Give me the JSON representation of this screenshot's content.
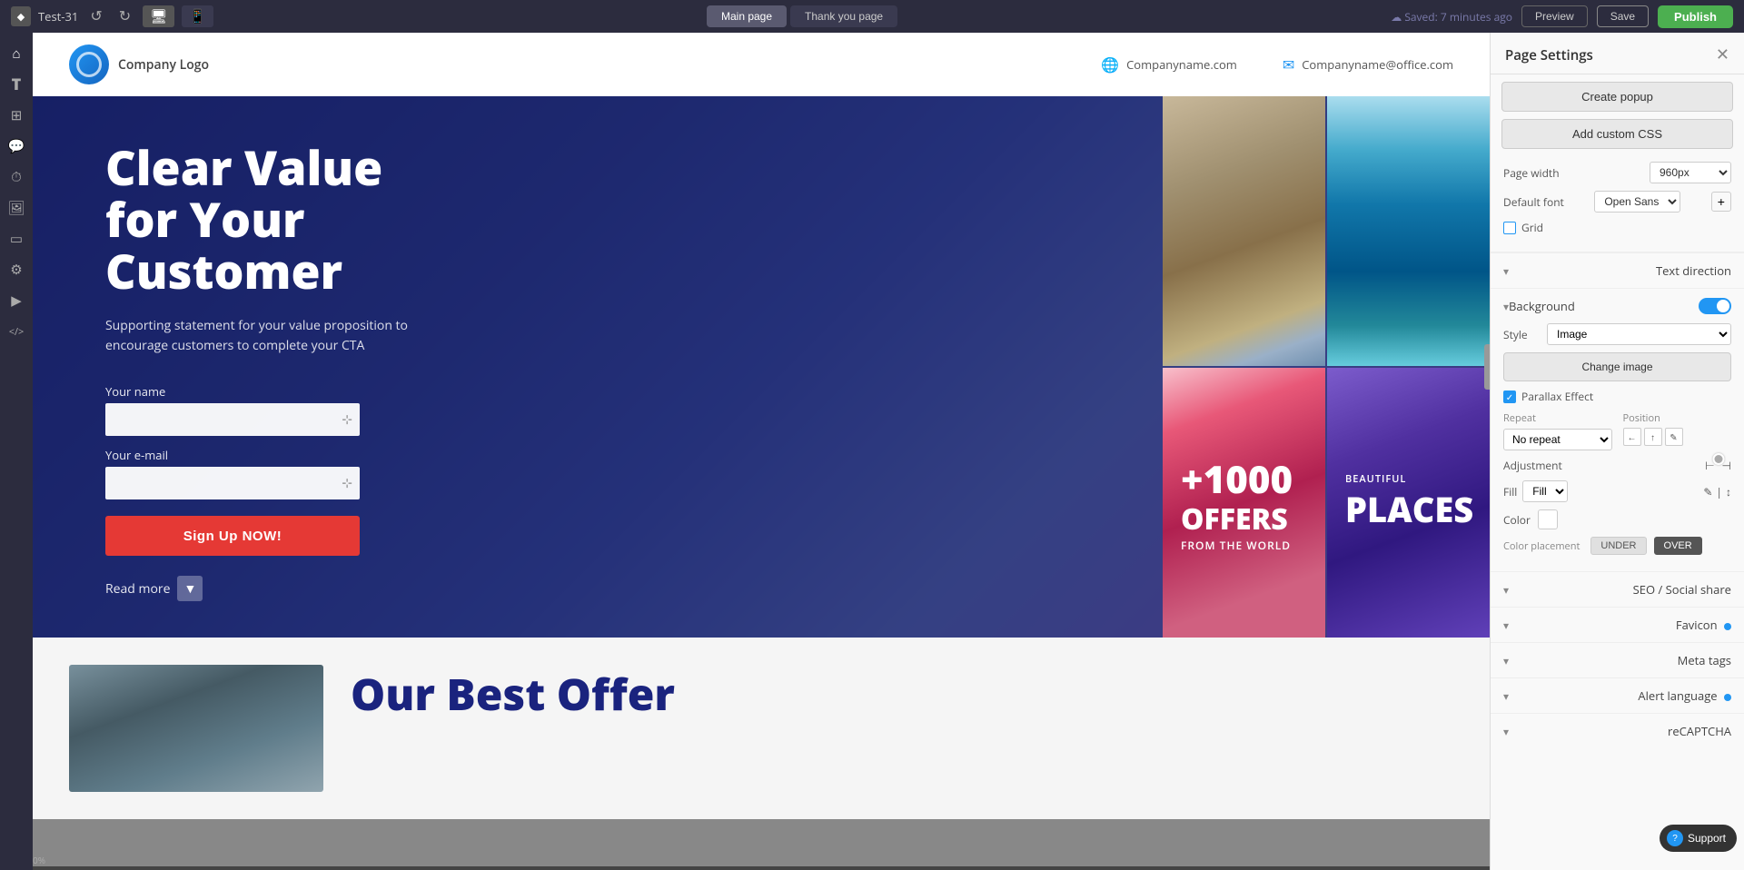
{
  "toolbar": {
    "project_name": "Test-31",
    "undo_label": "↺",
    "redo_label": "↻",
    "desktop_icon": "🖥",
    "mobile_icon": "📱",
    "page_tabs": [
      {
        "label": "Main page",
        "active": true
      },
      {
        "label": "Thank you page",
        "active": false
      }
    ],
    "saved_text": "Saved: 7 minutes ago",
    "preview_label": "Preview",
    "save_label": "Save",
    "publish_label": "Publish"
  },
  "left_sidebar": {
    "icons": [
      {
        "name": "home-icon",
        "symbol": "⌂"
      },
      {
        "name": "text-icon",
        "symbol": "T"
      },
      {
        "name": "elements-icon",
        "symbol": "⬜"
      },
      {
        "name": "comments-icon",
        "symbol": "💬"
      },
      {
        "name": "timer-icon",
        "symbol": "⏱"
      },
      {
        "name": "image-icon",
        "symbol": "🖼"
      },
      {
        "name": "section-icon",
        "symbol": "▭"
      },
      {
        "name": "apps-icon",
        "symbol": "⚙"
      },
      {
        "name": "video-icon",
        "symbol": "▶"
      },
      {
        "name": "code-icon",
        "symbol": "</>"
      }
    ]
  },
  "page_header": {
    "logo_alt": "Company Logo",
    "logo_text": "Company Logo",
    "phone_icon": "🌐",
    "company_name": "Companyname.com",
    "email_icon": "✉",
    "company_email": "Companyname@office.com"
  },
  "hero": {
    "title_line1": "Clear Value",
    "title_line2": "for Your",
    "title_line3": "Customer",
    "subtitle": "Supporting statement for your value proposition to encourage customers to complete your CTA",
    "name_label": "Your name",
    "email_label": "Your e-mail",
    "name_placeholder": "",
    "email_placeholder": "",
    "signup_button": "Sign Up NOW!",
    "read_more": "Read more"
  },
  "hero_grid": {
    "cell1_type": "pisa",
    "cell2_type": "arch",
    "cell3_type": "beach",
    "cell3_number": "+1000",
    "cell3_offers": "OFFERS",
    "cell3_sub": "FROM THE WORLD",
    "cell4_type": "tree",
    "cell4_title": "BEAUTIFUL",
    "cell4_places": "PLACES"
  },
  "offer_section": {
    "title": "Our Best Offer"
  },
  "right_panel": {
    "title": "Page Settings",
    "close_icon": "✕",
    "create_popup_label": "Create popup",
    "add_custom_css_label": "Add custom CSS",
    "page_width_label": "Page width",
    "page_width_value": "960px",
    "default_font_label": "Default font",
    "default_font_value": "Open Sans",
    "grid_label": "Grid",
    "text_direction_label": "Text direction",
    "background_label": "Background",
    "background_toggle": true,
    "style_label": "Style",
    "style_value": "Image",
    "change_image_label": "Change image",
    "parallax_label": "Parallax Effect",
    "parallax_checked": true,
    "repeat_label": "Repeat",
    "repeat_value": "No repeat",
    "position_label": "Position",
    "adjustment_label": "Adjustment",
    "fill_label": "Fill",
    "fill_value": "Fill",
    "color_label": "Color",
    "color_placement_label": "Color placement",
    "under_label": "UNDER",
    "over_label": "OVER",
    "seo_social_label": "SEO / Social share",
    "favicon_label": "Favicon",
    "meta_tags_label": "Meta tags",
    "alert_language_label": "Alert language",
    "recaptcha_label": "reCAPTCHA"
  },
  "support": {
    "label": "Support"
  },
  "progress": {
    "percent": "0%"
  }
}
